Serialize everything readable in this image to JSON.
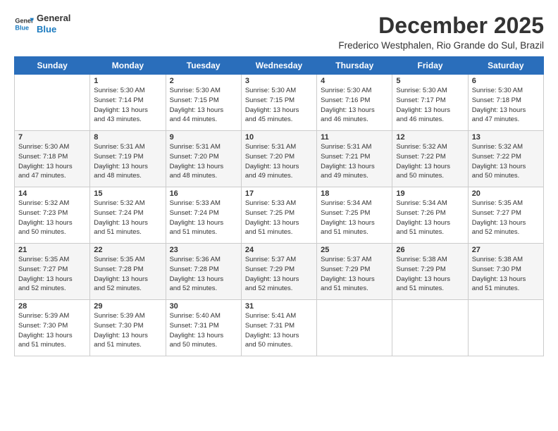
{
  "logo": {
    "line1": "General",
    "line2": "Blue"
  },
  "title": "December 2025",
  "subtitle": "Frederico Westphalen, Rio Grande do Sul, Brazil",
  "weekdays": [
    "Sunday",
    "Monday",
    "Tuesday",
    "Wednesday",
    "Thursday",
    "Friday",
    "Saturday"
  ],
  "weeks": [
    [
      {
        "day": "",
        "info": ""
      },
      {
        "day": "1",
        "info": "Sunrise: 5:30 AM\nSunset: 7:14 PM\nDaylight: 13 hours\nand 43 minutes."
      },
      {
        "day": "2",
        "info": "Sunrise: 5:30 AM\nSunset: 7:15 PM\nDaylight: 13 hours\nand 44 minutes."
      },
      {
        "day": "3",
        "info": "Sunrise: 5:30 AM\nSunset: 7:15 PM\nDaylight: 13 hours\nand 45 minutes."
      },
      {
        "day": "4",
        "info": "Sunrise: 5:30 AM\nSunset: 7:16 PM\nDaylight: 13 hours\nand 46 minutes."
      },
      {
        "day": "5",
        "info": "Sunrise: 5:30 AM\nSunset: 7:17 PM\nDaylight: 13 hours\nand 46 minutes."
      },
      {
        "day": "6",
        "info": "Sunrise: 5:30 AM\nSunset: 7:18 PM\nDaylight: 13 hours\nand 47 minutes."
      }
    ],
    [
      {
        "day": "7",
        "info": "Sunrise: 5:30 AM\nSunset: 7:18 PM\nDaylight: 13 hours\nand 47 minutes."
      },
      {
        "day": "8",
        "info": "Sunrise: 5:31 AM\nSunset: 7:19 PM\nDaylight: 13 hours\nand 48 minutes."
      },
      {
        "day": "9",
        "info": "Sunrise: 5:31 AM\nSunset: 7:20 PM\nDaylight: 13 hours\nand 48 minutes."
      },
      {
        "day": "10",
        "info": "Sunrise: 5:31 AM\nSunset: 7:20 PM\nDaylight: 13 hours\nand 49 minutes."
      },
      {
        "day": "11",
        "info": "Sunrise: 5:31 AM\nSunset: 7:21 PM\nDaylight: 13 hours\nand 49 minutes."
      },
      {
        "day": "12",
        "info": "Sunrise: 5:32 AM\nSunset: 7:22 PM\nDaylight: 13 hours\nand 50 minutes."
      },
      {
        "day": "13",
        "info": "Sunrise: 5:32 AM\nSunset: 7:22 PM\nDaylight: 13 hours\nand 50 minutes."
      }
    ],
    [
      {
        "day": "14",
        "info": "Sunrise: 5:32 AM\nSunset: 7:23 PM\nDaylight: 13 hours\nand 50 minutes."
      },
      {
        "day": "15",
        "info": "Sunrise: 5:32 AM\nSunset: 7:24 PM\nDaylight: 13 hours\nand 51 minutes."
      },
      {
        "day": "16",
        "info": "Sunrise: 5:33 AM\nSunset: 7:24 PM\nDaylight: 13 hours\nand 51 minutes."
      },
      {
        "day": "17",
        "info": "Sunrise: 5:33 AM\nSunset: 7:25 PM\nDaylight: 13 hours\nand 51 minutes."
      },
      {
        "day": "18",
        "info": "Sunrise: 5:34 AM\nSunset: 7:25 PM\nDaylight: 13 hours\nand 51 minutes."
      },
      {
        "day": "19",
        "info": "Sunrise: 5:34 AM\nSunset: 7:26 PM\nDaylight: 13 hours\nand 51 minutes."
      },
      {
        "day": "20",
        "info": "Sunrise: 5:35 AM\nSunset: 7:27 PM\nDaylight: 13 hours\nand 52 minutes."
      }
    ],
    [
      {
        "day": "21",
        "info": "Sunrise: 5:35 AM\nSunset: 7:27 PM\nDaylight: 13 hours\nand 52 minutes."
      },
      {
        "day": "22",
        "info": "Sunrise: 5:35 AM\nSunset: 7:28 PM\nDaylight: 13 hours\nand 52 minutes."
      },
      {
        "day": "23",
        "info": "Sunrise: 5:36 AM\nSunset: 7:28 PM\nDaylight: 13 hours\nand 52 minutes."
      },
      {
        "day": "24",
        "info": "Sunrise: 5:37 AM\nSunset: 7:29 PM\nDaylight: 13 hours\nand 52 minutes."
      },
      {
        "day": "25",
        "info": "Sunrise: 5:37 AM\nSunset: 7:29 PM\nDaylight: 13 hours\nand 51 minutes."
      },
      {
        "day": "26",
        "info": "Sunrise: 5:38 AM\nSunset: 7:29 PM\nDaylight: 13 hours\nand 51 minutes."
      },
      {
        "day": "27",
        "info": "Sunrise: 5:38 AM\nSunset: 7:30 PM\nDaylight: 13 hours\nand 51 minutes."
      }
    ],
    [
      {
        "day": "28",
        "info": "Sunrise: 5:39 AM\nSunset: 7:30 PM\nDaylight: 13 hours\nand 51 minutes."
      },
      {
        "day": "29",
        "info": "Sunrise: 5:39 AM\nSunset: 7:30 PM\nDaylight: 13 hours\nand 51 minutes."
      },
      {
        "day": "30",
        "info": "Sunrise: 5:40 AM\nSunset: 7:31 PM\nDaylight: 13 hours\nand 50 minutes."
      },
      {
        "day": "31",
        "info": "Sunrise: 5:41 AM\nSunset: 7:31 PM\nDaylight: 13 hours\nand 50 minutes."
      },
      {
        "day": "",
        "info": ""
      },
      {
        "day": "",
        "info": ""
      },
      {
        "day": "",
        "info": ""
      }
    ]
  ]
}
